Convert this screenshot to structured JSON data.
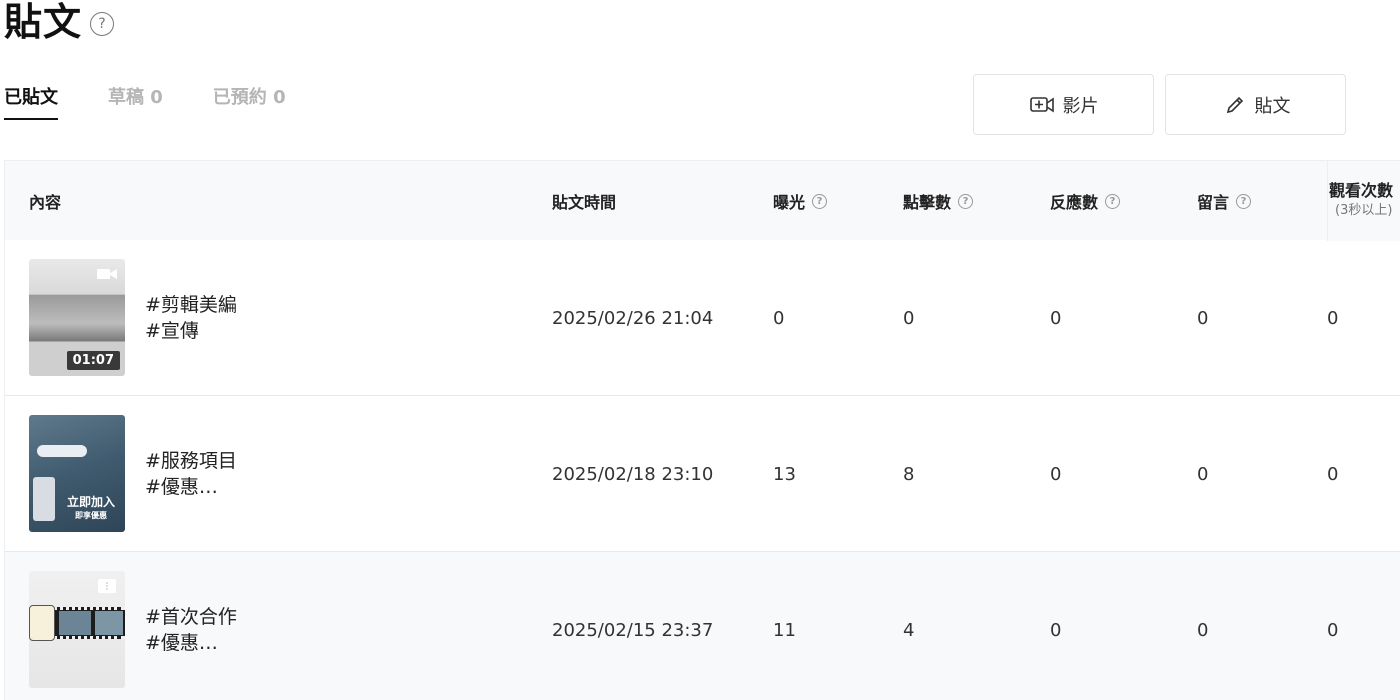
{
  "title": "貼文",
  "tabs": [
    {
      "label": "已貼文",
      "active": true
    },
    {
      "label": "草稿 0",
      "active": false
    },
    {
      "label": "已預約 0",
      "active": false
    }
  ],
  "buttons": {
    "video": "影片",
    "post": "貼文"
  },
  "columns": {
    "content": "內容",
    "time": "貼文時間",
    "impressions": "曝光",
    "clicks": "點擊數",
    "reactions": "反應數",
    "comments": "留言",
    "views": "觀看次數",
    "views_sub": "(3秒以上)"
  },
  "rows": [
    {
      "tag1": "#剪輯美編",
      "tag2": "#宣傳",
      "duration": "01:07",
      "time": "2025/02/26 21:04",
      "impressions": "0",
      "clicks": "0",
      "reactions": "0",
      "comments": "0",
      "views": "0"
    },
    {
      "tag1": "#服務項目",
      "tag2": "#優惠…",
      "time": "2025/02/18 23:10",
      "impressions": "13",
      "clicks": "8",
      "reactions": "0",
      "comments": "0",
      "views": "0",
      "overlay1": "立即加入",
      "overlay2": "即享優惠"
    },
    {
      "tag1": "#首次合作",
      "tag2": "#優惠…",
      "time": "2025/02/15 23:37",
      "impressions": "11",
      "clicks": "4",
      "reactions": "0",
      "comments": "0",
      "views": "0"
    }
  ],
  "colors": {
    "accent": "#111111",
    "muted_tab": "#b5b5b5",
    "header_bg": "#f8f9fb"
  }
}
